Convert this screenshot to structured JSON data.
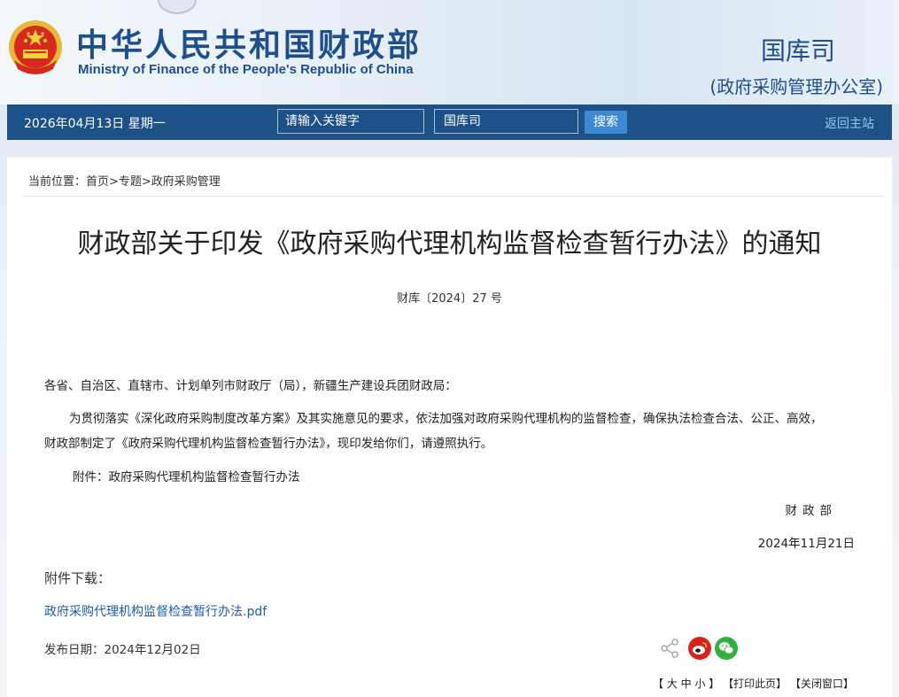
{
  "header": {
    "site_title_cn": "中华人民共和国财政部",
    "site_title_en": "Ministry of Finance of the People's Republic of China",
    "department": "国库司",
    "department_sub": "(政府采购管理办公室)"
  },
  "navbar": {
    "date": "2026年04月13日  星期一",
    "search_placeholder": "请输入关键字",
    "search_scope": "国库司",
    "search_button": "搜索",
    "home_link": "返回主站"
  },
  "breadcrumb": "当前位置：首页>专题>政府采购管理",
  "article": {
    "title": "财政部关于印发《政府采购代理机构监督检查暂行办法》的通知",
    "doc_number": "财库〔2024〕27 号",
    "salutation": "各省、自治区、直辖市、计划单列市财政厅（局），新疆生产建设兵团财政局：",
    "body_line1": "为贯彻落实《深化政府采购制度改革方案》及其实施意见的要求，依法加强对政府采购代理机构的监督检查，确保执法检查合法、公正、高效，",
    "body_line2": "财政部制定了《政府采购代理机构监督检查暂行办法》，现印发给你们，请遵照执行。",
    "attachment_note": "附件：政府采购代理机构监督检查暂行办法",
    "signature": "财政部",
    "sign_date": "2024年11月21日"
  },
  "attachments": {
    "label": "附件下载：",
    "file": "政府采购代理机构监督检查暂行办法.pdf"
  },
  "publish_date": "发布日期：2024年12月02日",
  "tools": {
    "font_size": "【 大 中 小 】",
    "print": "【打印此页】",
    "close": "【关闭窗口】"
  },
  "colors": {
    "nav_bg": "#1d5187",
    "brand_blue": "#1f4e8c",
    "link_blue": "#1d5cae",
    "weibo_red": "#d9201e",
    "wechat_green": "#33b03f"
  }
}
